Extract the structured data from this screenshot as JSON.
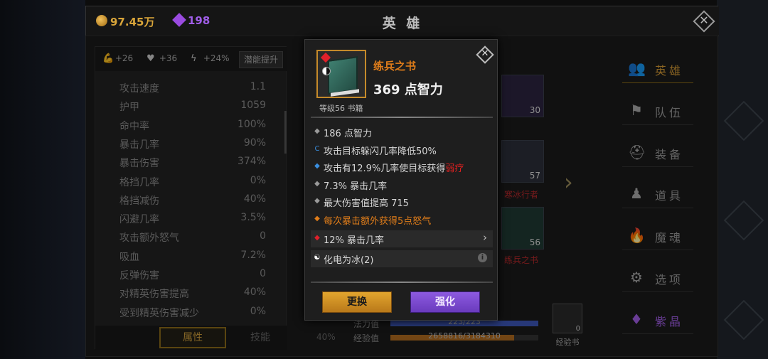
{
  "header": {
    "coins": "97.45万",
    "gems": "198",
    "title": "英 雄"
  },
  "buffs": [
    {
      "icon": "strength-icon",
      "value": "+26"
    },
    {
      "icon": "heart-icon",
      "value": "+36"
    },
    {
      "icon": "lightning-icon",
      "value": "+24%"
    }
  ],
  "potential_button": "潜能提升",
  "stats": [
    {
      "label": "攻击速度",
      "value": "1.1"
    },
    {
      "label": "护甲",
      "value": "1059"
    },
    {
      "label": "命中率",
      "value": "100%"
    },
    {
      "label": "暴击几率",
      "value": "90%"
    },
    {
      "label": "暴击伤害",
      "value": "374%"
    },
    {
      "label": "格挡几率",
      "value": "0%"
    },
    {
      "label": "格挡减伤",
      "value": "40%"
    },
    {
      "label": "闪避几率",
      "value": "3.5%"
    },
    {
      "label": "攻击额外怒气",
      "value": "0"
    },
    {
      "label": "吸血",
      "value": "7.2%"
    },
    {
      "label": "反弹伤害",
      "value": "0"
    },
    {
      "label": "对精英伤害提高",
      "value": "40%"
    },
    {
      "label": "受到精英伤害减少",
      "value": "0%"
    }
  ],
  "tabs": {
    "attributes": "属性",
    "skills": "技能"
  },
  "hero_area": {
    "hero_level": "30",
    "equip1_count": "57",
    "equip1_name": "寒冰行者",
    "equip2_count": "56",
    "equip2_name": "练兵之书",
    "mana_label": "法力值",
    "mana_value": "223/223",
    "mana_fill": 1.0,
    "xp_label": "经验值",
    "xp_value": "2658816/3184310",
    "xp_fill": 0.835,
    "pct": "40%",
    "xp_book_label": "经验书",
    "xp_book_count": "0"
  },
  "menu": [
    {
      "icon": "users-icon",
      "label": "英雄",
      "state": "active"
    },
    {
      "icon": "flag-icon",
      "label": "队伍",
      "state": "normal"
    },
    {
      "icon": "helmet-icon",
      "label": "装备",
      "state": "normal"
    },
    {
      "icon": "bag-icon",
      "label": "道具",
      "state": "normal"
    },
    {
      "icon": "flame-icon",
      "label": "魔魂",
      "state": "normal"
    },
    {
      "icon": "gear-icon",
      "label": "选项",
      "state": "normal"
    },
    {
      "icon": "crystal-icon",
      "label": "紫晶",
      "state": "purple"
    }
  ],
  "popup": {
    "name": "练兵之书",
    "main_stat": "369 点智力",
    "level_info": "等级56 书籍",
    "attributes": [
      {
        "bullet": "◆",
        "bullet_color": "#9a9a9a",
        "text": "186 点智力",
        "style": "normal"
      },
      {
        "bullet": "C",
        "bullet_color": "#3a8fe0",
        "text": "攻击目标躲闪几率降低50%",
        "style": "normal"
      },
      {
        "bullet": "◆",
        "bullet_color": "#3a8fe0",
        "text": "攻击有12.9%几率使目标获得",
        "highlight": "弱疗",
        "style": "normal"
      },
      {
        "bullet": "◆",
        "bullet_color": "#9a9a9a",
        "text": "7.3% 暴击几率",
        "style": "normal"
      },
      {
        "bullet": "◆",
        "bullet_color": "#9a9a9a",
        "text": "最大伤害值提高 715",
        "style": "normal"
      },
      {
        "bullet": "◆",
        "bullet_color": "#e07d1a",
        "text": "每次暴击额外获得5点怒气",
        "style": "orange"
      }
    ],
    "socket_gem": {
      "text": "12% 暴击几率",
      "chevron": "›"
    },
    "set_bonus": {
      "text": "化电为冰(2)",
      "info": "i"
    },
    "replace_button": "更换",
    "enhance_button": "强化"
  }
}
